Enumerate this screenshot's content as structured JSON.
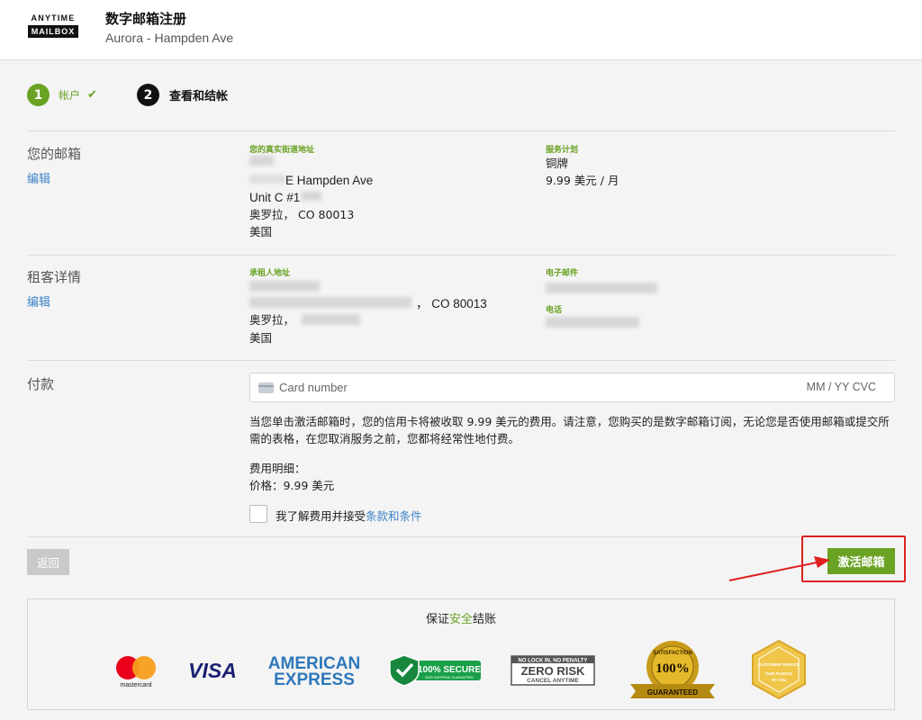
{
  "header": {
    "logo_line1": "ANYTIME",
    "logo_line2": "MAILBOX",
    "title": "数字邮箱注册",
    "subtitle": "Aurora - Hampden Ave"
  },
  "steps": [
    {
      "number": "1",
      "label": "帐户",
      "status": "completed",
      "check_icon": "check-icon"
    },
    {
      "number": "2",
      "label": "查看和结帐",
      "status": "current"
    }
  ],
  "mailbox": {
    "title": "您的邮箱",
    "edit": "编辑",
    "address_label": "您的真实街道地址",
    "address_lines": [
      "E Hampden Ave",
      "Unit C #1",
      "奥罗拉， CO 80013",
      "美国"
    ],
    "plan_label": "服务计划",
    "plan_name": "铜牌",
    "plan_price": "9.99 美元 / 月"
  },
  "renter": {
    "title": "租客详情",
    "edit": "编辑",
    "address_label": "承租人地址",
    "address_line2_suffix": "， CO 80013",
    "address_line3": "奥罗拉，",
    "address_line4": "美国",
    "email_label": "电子邮件",
    "phone_label": "电话"
  },
  "payment": {
    "title": "付款",
    "card_placeholder": "Card number",
    "card_exp_cvc": "MM / YY  CVC",
    "notice": "当您单击激活邮箱时，您的信用卡将被收取 9.99 美元的费用。请注意，您购买的是数字邮箱订阅，无论您是否使用邮箱或提交所需的表格，在您取消服务之前，您都将经常性地付费。",
    "detail_title": "费用明细：",
    "price_line": "价格：9.99 美元",
    "accept_prefix": "我了解费用并接受",
    "terms_link": "条款和条件"
  },
  "actions": {
    "back": "返回",
    "activate": "激活邮箱"
  },
  "secure": {
    "title_prefix": "保证",
    "title_green": "安全",
    "title_suffix": "结账",
    "badges": {
      "mastercard": "mastercard",
      "visa": "VISA",
      "amex_1": "AMERICAN",
      "amex_2": "EXPRESS",
      "secure_main": "100% SECURE",
      "secure_sub": "SAFE SHOPPING GUARANTEED",
      "zero_top": "NO LOCK IN, NO PENALTY",
      "zero_main": "ZERO RISK",
      "zero_bottom": "CANCEL ANYTIME",
      "sat_top": "SATISFACTION",
      "sat_main": "100%",
      "sat_ribbon": "GUARANTEED",
      "cs_top": "CUSTOMER SERVICE",
      "cs_mid": "OUR PLEDGE",
      "cs_bottom": "TO YOU"
    }
  },
  "colors": {
    "accent_green": "#6aa223",
    "link_blue": "#3d83c6",
    "annotation_red": "#e02020"
  }
}
